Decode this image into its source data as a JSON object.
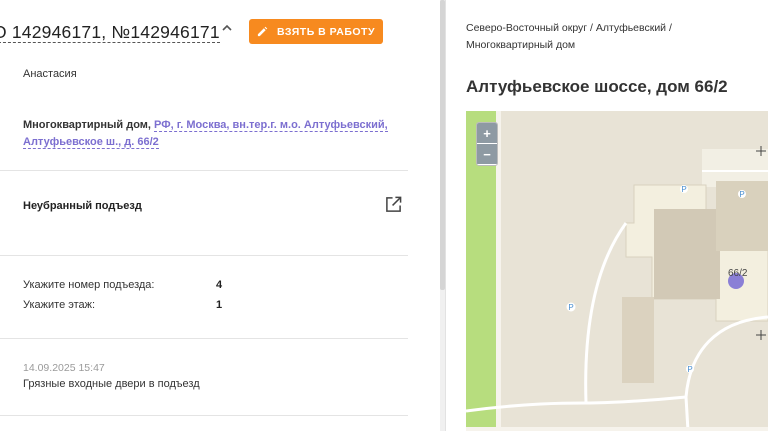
{
  "request": {
    "title": "О 142946171, №142946171",
    "take_button": "ВЗЯТЬ В РАБОТУ",
    "author": "Анастасия",
    "address_type": "Многоквартирный дом,",
    "address_link": "РФ, г. Москва, вн.тер.г. м.о. Алтуфьевский, Алтуфьевское ш., д. 66/2",
    "category": "Неубранный подъезд",
    "params": [
      {
        "label": "Укажите номер подъезда:",
        "value": "4"
      },
      {
        "label": "Укажите этаж:",
        "value": "1"
      }
    ],
    "comment": {
      "date": "14.09.2025 15:47",
      "text": "Грязные входные двери в подъезд"
    }
  },
  "location": {
    "breadcrumb_line1": "Северо-Восточный округ / Алтуфьевский /",
    "breadcrumb_line2": "Многоквартирный дом",
    "title": "Алтуфьевское шоссе, дом 66/2",
    "house_number": "66/2",
    "zoom_in": "+",
    "zoom_out": "−",
    "parking_label": "P"
  },
  "colors": {
    "accent": "#f78a1f",
    "link": "#7c6fd0",
    "marker": "#8a7fd6",
    "map_green": "#b7dd7e"
  }
}
